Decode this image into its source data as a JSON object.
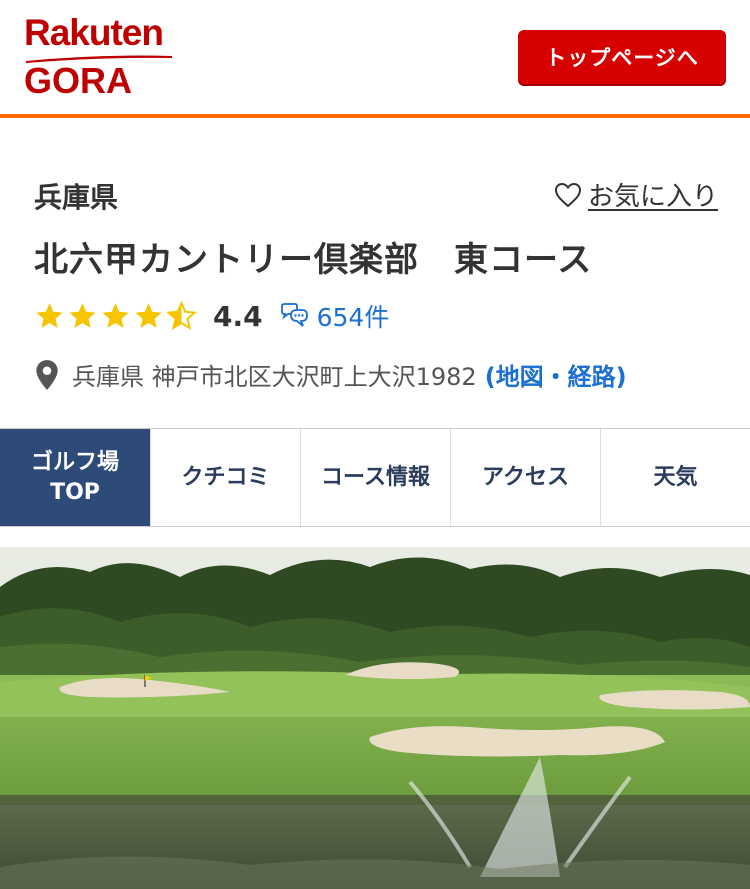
{
  "header": {
    "logo_brand": "Rakuten",
    "logo_service": "GORA",
    "top_button_label": "トップページへ"
  },
  "course": {
    "prefecture": "兵庫県",
    "favorite_label": "お気に入り",
    "name": "北六甲カントリー倶楽部　東コース",
    "rating": 4.4,
    "rating_label": "4.4",
    "review_count_label": "654件",
    "address": "兵庫県 神戸市北区大沢町上大沢1982",
    "map_link_label": "(地図・経路)"
  },
  "tabs": [
    {
      "label": "ゴルフ場\nTOP",
      "active": true
    },
    {
      "label": "クチコミ",
      "active": false
    },
    {
      "label": "コース情報",
      "active": false
    },
    {
      "label": "アクセス",
      "active": false
    },
    {
      "label": "天気",
      "active": false
    }
  ],
  "colors": {
    "brand_red": "#bf0000",
    "button_red": "#d60000",
    "accent_orange": "#ff6b00",
    "star_yellow": "#f7c400",
    "link_blue": "#1d6fd1",
    "tab_active_bg": "#2d4a79"
  },
  "icons": {
    "favorite": "heart-outline-icon",
    "review": "speech-bubbles-icon",
    "location": "map-pin-icon"
  }
}
